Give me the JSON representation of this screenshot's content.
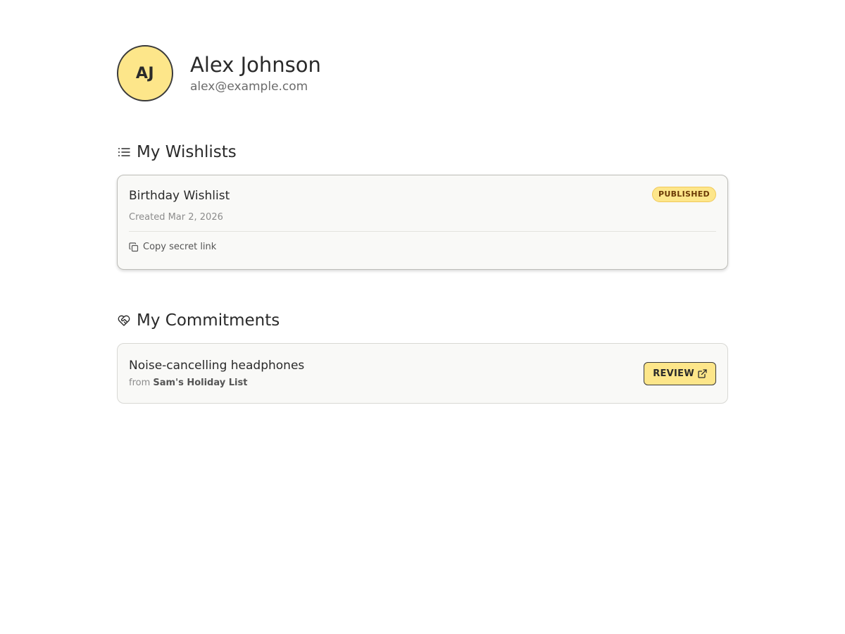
{
  "profile": {
    "initials": "AJ",
    "name": "Alex Johnson",
    "email": "alex@example.com",
    "avatar_color": "#fde68a"
  },
  "wishlists": {
    "title": "My Wishlists",
    "icon": "list-icon",
    "items": [
      {
        "title": "Birthday Wishlist",
        "status": "PUBLISHED",
        "created": "Created Mar 2, 2026",
        "copy_label": "Copy secret link",
        "copy_icon": "copy-icon"
      }
    ]
  },
  "commitments": {
    "title": "My Commitments",
    "icon": "heart-handshake-icon",
    "items": [
      {
        "title": "Noise-cancelling headphones",
        "from_prefix": "from",
        "from_list": "Sam's Holiday List",
        "action_label": "REVIEW",
        "action_icon": "external-link-icon"
      }
    ]
  },
  "colors": {
    "accent": "#fde68a",
    "badge_text": "#6b3a06"
  }
}
